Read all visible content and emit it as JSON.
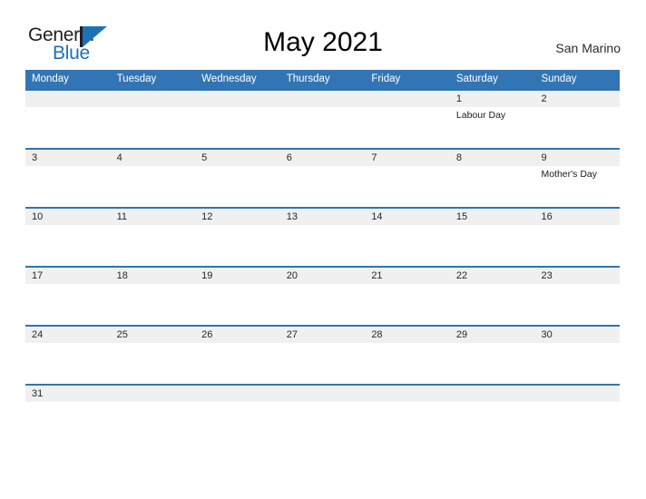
{
  "header": {
    "logo": {
      "word1": "General",
      "word2": "Blue",
      "flag_icon": "triangle-flag-icon",
      "color_dark": "#231f20",
      "color_blue": "#1b72b8"
    },
    "title": "May 2021",
    "region": "San Marino"
  },
  "calendar": {
    "accent_color": "#3275b4",
    "row_line_color": "#2e74b5",
    "band_color": "#f0f0f0",
    "weekdays": [
      "Monday",
      "Tuesday",
      "Wednesday",
      "Thursday",
      "Friday",
      "Saturday",
      "Sunday"
    ],
    "weeks": [
      [
        {
          "day": "",
          "event": ""
        },
        {
          "day": "",
          "event": ""
        },
        {
          "day": "",
          "event": ""
        },
        {
          "day": "",
          "event": ""
        },
        {
          "day": "",
          "event": ""
        },
        {
          "day": "1",
          "event": "Labour Day"
        },
        {
          "day": "2",
          "event": ""
        }
      ],
      [
        {
          "day": "3",
          "event": ""
        },
        {
          "day": "4",
          "event": ""
        },
        {
          "day": "5",
          "event": ""
        },
        {
          "day": "6",
          "event": ""
        },
        {
          "day": "7",
          "event": ""
        },
        {
          "day": "8",
          "event": ""
        },
        {
          "day": "9",
          "event": "Mother's Day"
        }
      ],
      [
        {
          "day": "10",
          "event": ""
        },
        {
          "day": "11",
          "event": ""
        },
        {
          "day": "12",
          "event": ""
        },
        {
          "day": "13",
          "event": ""
        },
        {
          "day": "14",
          "event": ""
        },
        {
          "day": "15",
          "event": ""
        },
        {
          "day": "16",
          "event": ""
        }
      ],
      [
        {
          "day": "17",
          "event": ""
        },
        {
          "day": "18",
          "event": ""
        },
        {
          "day": "19",
          "event": ""
        },
        {
          "day": "20",
          "event": ""
        },
        {
          "day": "21",
          "event": ""
        },
        {
          "day": "22",
          "event": ""
        },
        {
          "day": "23",
          "event": ""
        }
      ],
      [
        {
          "day": "24",
          "event": ""
        },
        {
          "day": "25",
          "event": ""
        },
        {
          "day": "26",
          "event": ""
        },
        {
          "day": "27",
          "event": ""
        },
        {
          "day": "28",
          "event": ""
        },
        {
          "day": "29",
          "event": ""
        },
        {
          "day": "30",
          "event": ""
        }
      ],
      [
        {
          "day": "31",
          "event": ""
        },
        {
          "day": "",
          "event": ""
        },
        {
          "day": "",
          "event": ""
        },
        {
          "day": "",
          "event": ""
        },
        {
          "day": "",
          "event": ""
        },
        {
          "day": "",
          "event": ""
        },
        {
          "day": "",
          "event": ""
        }
      ]
    ]
  }
}
